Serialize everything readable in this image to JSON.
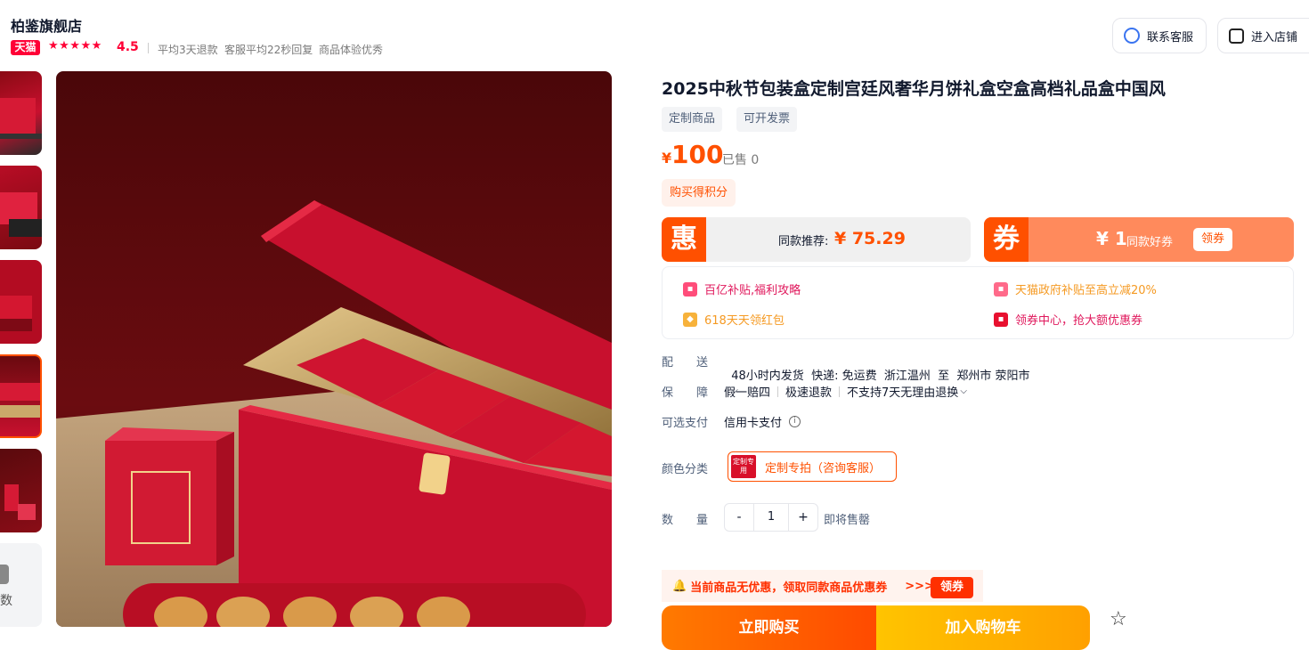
{
  "shop": {
    "name": "柏鉴旗舰店",
    "badge": "天猫",
    "stars": "★★★★★",
    "rating": "4.5",
    "meta": [
      "平均3天退款",
      "客服平均22秒回复",
      "商品体验优秀"
    ],
    "contact_label": "联系客服",
    "enter_label": "进入店铺"
  },
  "gallery": {
    "more_label": "数",
    "selected_index": 3
  },
  "product": {
    "title": "2025中秋节包装盒定制宫廷风奢华月饼礼盒空盒高档礼品盒中国风",
    "tags": [
      "定制商品",
      "可开发票"
    ],
    "price_symbol": "¥",
    "price": "100",
    "sold": "· 已售 0",
    "points": "购买得积分"
  },
  "deal": {
    "icon_char": "惠",
    "label": "同款推荐:",
    "price": "¥ 75.29"
  },
  "coupon": {
    "icon_char": "券",
    "amount": "¥ 1",
    "label": "同款好券",
    "button": "领券"
  },
  "benefits": [
    {
      "text": "百亿补贴,福利攻略",
      "color": "#e0185c"
    },
    {
      "text": "天猫政府补贴至高立减20%",
      "color": "#f59a23"
    },
    {
      "text": "618天天领红包",
      "color": "#f59a23"
    },
    {
      "text": "领券中心，抢大额优惠券",
      "color": "#e0185c"
    }
  ],
  "delivery": {
    "label": "配　　送",
    "value": "48小时内发货  快递: 免运费  浙江温州  至  郑州市 荥阳市"
  },
  "guarantee": {
    "label": "保　　障",
    "items": [
      "假一赔四",
      "极速退款",
      "不支持7天无理由退换"
    ]
  },
  "payment": {
    "label": "可选支付",
    "value": "信用卡支付"
  },
  "sku": {
    "label": "颜色分类",
    "thumb_text": "定制专用",
    "option": "定制专拍（咨询客服）"
  },
  "quantity": {
    "label": "数　　量",
    "minus": "-",
    "value": "1",
    "plus": "+",
    "stock": "即将售罄"
  },
  "promo": {
    "text": "当前商品无优惠，领取同款商品优惠券",
    "arrows": ">>>",
    "button": "领券"
  },
  "actions": {
    "buy": "立即购买",
    "cart": "加入购物车",
    "fav_icon": "☆"
  }
}
